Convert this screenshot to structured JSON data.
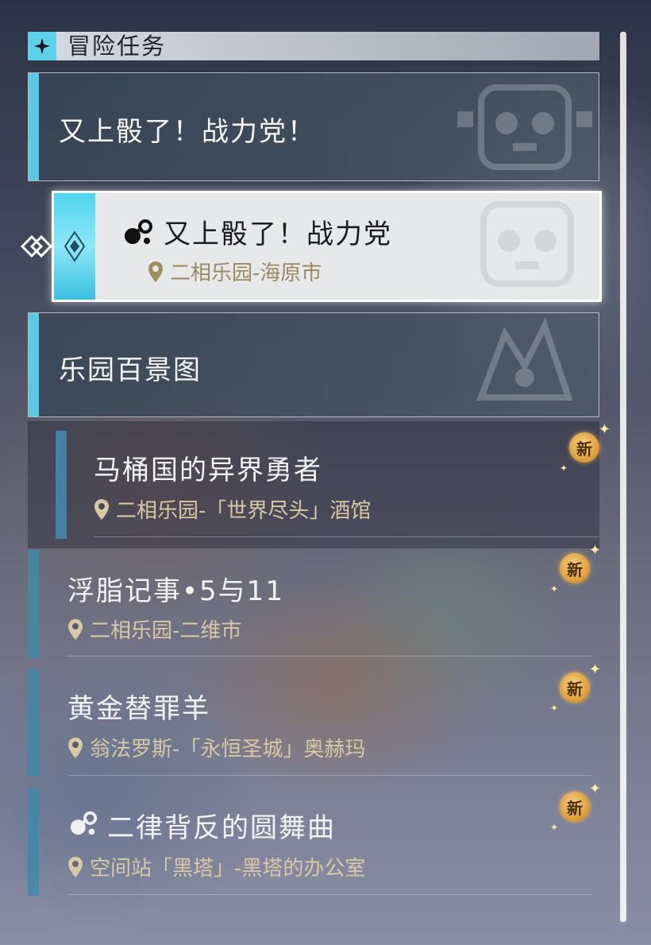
{
  "header": {
    "title": "冒险任务",
    "icon": "four-point-star-icon"
  },
  "categories": [
    {
      "title": "又上骰了！战力党！"
    },
    {
      "title": "乐园百景图"
    }
  ],
  "selected_quest": {
    "title": "又上骰了！战力党",
    "location": "二相乐园-海原市"
  },
  "quests": [
    {
      "title": "马桶国的异界勇者",
      "location": "二相乐园-「世界尽头」酒馆",
      "badge": "新"
    },
    {
      "title": "浮脂记事•5与11",
      "location": "二相乐园-二维市",
      "badge": "新"
    },
    {
      "title": "黄金替罪羊",
      "location": "翁法罗斯-「永恒圣城」奥赫玛",
      "badge": "新"
    },
    {
      "title": "二律背反的圆舞曲",
      "location": "空间站「黑塔」-黑塔的办公室",
      "badge": "新"
    }
  ],
  "colors": {
    "accent": "#5cc8e4",
    "sub_accent": "#3f8aa8",
    "location_gold": "#d7c9a4",
    "badge": "#d9972f"
  }
}
